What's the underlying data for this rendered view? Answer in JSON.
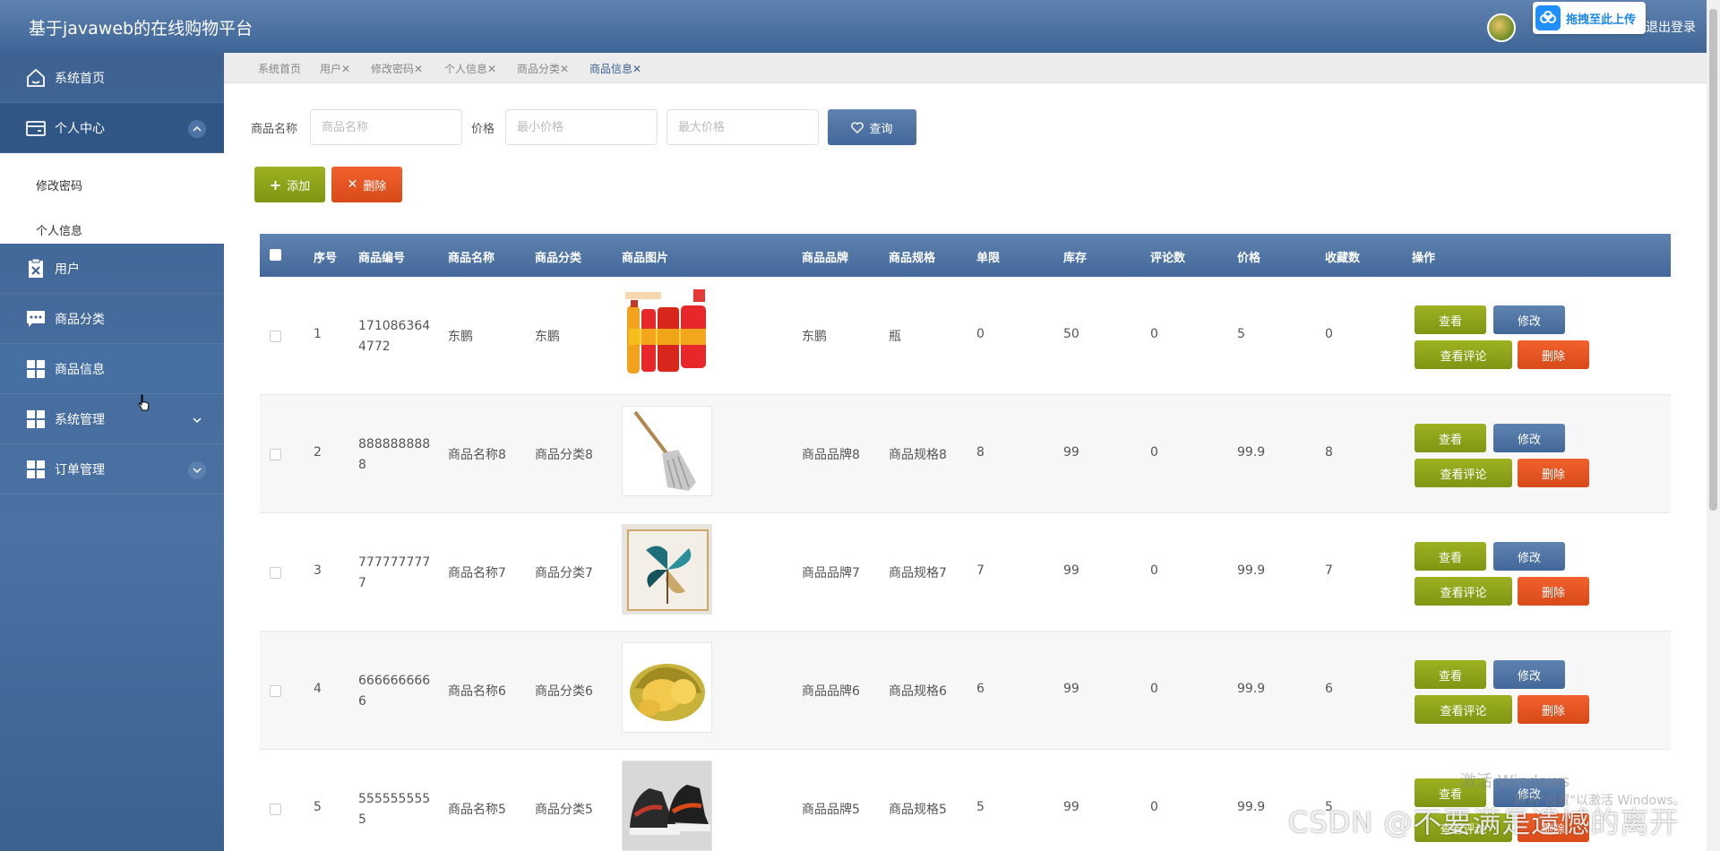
{
  "app": {
    "title": "基于javaweb的在线购物平台",
    "upload_label": "拖拽至此上传",
    "logout": "退出登录"
  },
  "sidebar": {
    "items": [
      {
        "label": "系统首页",
        "icon": "home-icon"
      },
      {
        "label": "个人中心",
        "icon": "card-icon",
        "expanded": true
      },
      {
        "label": "用户",
        "icon": "clipboard-icon"
      },
      {
        "label": "商品分类",
        "icon": "chat-icon"
      },
      {
        "label": "商品信息",
        "icon": "grid-icon",
        "active": true
      },
      {
        "label": "系统管理",
        "icon": "grid-icon"
      },
      {
        "label": "订单管理",
        "icon": "grid-icon"
      }
    ],
    "sub_items": [
      "修改密码",
      "个人信息"
    ]
  },
  "tabs": [
    "系统首页",
    "用户",
    "修改密码",
    "个人信息",
    "商品分类",
    "商品信息"
  ],
  "search": {
    "name_label": "商品名称",
    "name_placeholder": "商品名称",
    "price_label": "价格",
    "min_placeholder": "最小价格",
    "max_placeholder": "最大价格",
    "query_label": "查询"
  },
  "actions": {
    "add_label": "添加",
    "delete_label": "删除"
  },
  "table": {
    "headers": [
      "序号",
      "商品编号",
      "商品名称",
      "商品分类",
      "商品图片",
      "商品品牌",
      "商品规格",
      "单限",
      "库存",
      "评论数",
      "价格",
      "收藏数",
      "操作"
    ],
    "row_actions": {
      "view": "查看",
      "edit": "修改",
      "comments": "查看评论",
      "remove": "删除"
    },
    "rows": [
      {
        "no": "1",
        "code": "1710863644772",
        "name": "东鹏",
        "category": "东鹏",
        "brand": "东鹏",
        "spec": "瓶",
        "limit": "0",
        "stock": "50",
        "comments": "0",
        "price": "5",
        "favorites": "0"
      },
      {
        "no": "2",
        "code": "8888888888",
        "name": "商品名称8",
        "category": "商品分类8",
        "brand": "商品品牌8",
        "spec": "商品规格8",
        "limit": "8",
        "stock": "99",
        "comments": "0",
        "price": "99.9",
        "favorites": "8"
      },
      {
        "no": "3",
        "code": "7777777777",
        "name": "商品名称7",
        "category": "商品分类7",
        "brand": "商品品牌7",
        "spec": "商品规格7",
        "limit": "7",
        "stock": "99",
        "comments": "0",
        "price": "99.9",
        "favorites": "7"
      },
      {
        "no": "4",
        "code": "6666666666",
        "name": "商品名称6",
        "category": "商品分类6",
        "brand": "商品品牌6",
        "spec": "商品规格6",
        "limit": "6",
        "stock": "99",
        "comments": "0",
        "price": "99.9",
        "favorites": "6"
      },
      {
        "no": "5",
        "code": "5555555555",
        "name": "商品名称5",
        "category": "商品分类5",
        "brand": "商品品牌5",
        "spec": "商品规格5",
        "limit": "5",
        "stock": "99",
        "comments": "0",
        "price": "99.9",
        "favorites": "5"
      }
    ]
  },
  "watermarks": {
    "csdn": "CSDN @不要满是遗憾的离开",
    "windows": "激活 Windows",
    "windows_sub": "转到\"设置\"以激活 Windows。"
  },
  "colors": {
    "header": "#4a72a3",
    "olive": "#8ca31a",
    "orange": "#e85522",
    "sidebar": "#3d6291"
  }
}
